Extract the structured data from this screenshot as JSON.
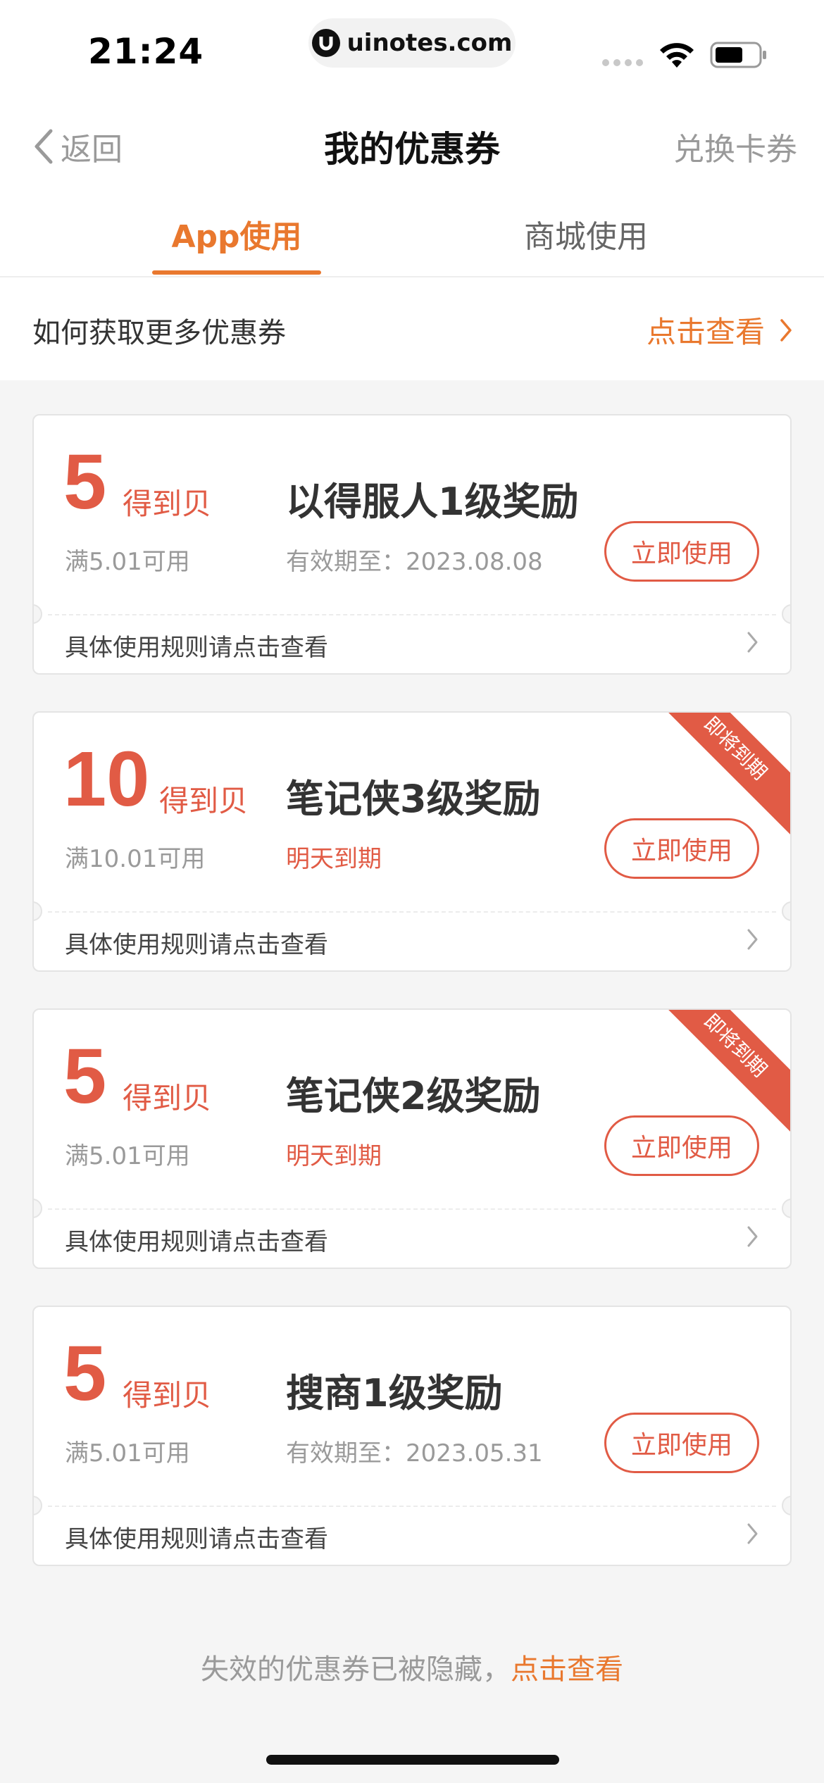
{
  "status_bar": {
    "time": "21:24",
    "url": "uinotes.com"
  },
  "nav": {
    "back_label": "返回",
    "title": "我的优惠券",
    "right_action": "兑换卡券"
  },
  "tabs": [
    {
      "label": "App使用",
      "active": true
    },
    {
      "label": "商城使用",
      "active": false
    }
  ],
  "info_row": {
    "label": "如何获取更多优惠券",
    "link": "点击查看"
  },
  "coupons": [
    {
      "amount": "5",
      "unit": "得到贝",
      "min_use": "满5.01可用",
      "title": "以得服人1级奖励",
      "expiry": "有效期至：2023.08.08",
      "expiry_urgent": false,
      "button": "立即使用",
      "rules": "具体使用规则请点击查看",
      "ribbon": ""
    },
    {
      "amount": "10",
      "unit": "得到贝",
      "min_use": "满10.01可用",
      "title": "笔记侠3级奖励",
      "expiry": "明天到期",
      "expiry_urgent": true,
      "button": "立即使用",
      "rules": "具体使用规则请点击查看",
      "ribbon": "即将到期"
    },
    {
      "amount": "5",
      "unit": "得到贝",
      "min_use": "满5.01可用",
      "title": "笔记侠2级奖励",
      "expiry": "明天到期",
      "expiry_urgent": true,
      "button": "立即使用",
      "rules": "具体使用规则请点击查看",
      "ribbon": "即将到期"
    },
    {
      "amount": "5",
      "unit": "得到贝",
      "min_use": "满5.01可用",
      "title": "搜商1级奖励",
      "expiry": "有效期至：2023.05.31",
      "expiry_urgent": false,
      "button": "立即使用",
      "rules": "具体使用规则请点击查看",
      "ribbon": ""
    }
  ],
  "footer": {
    "hidden_text": "失效的优惠券已被隐藏，",
    "hidden_link": "点击查看"
  },
  "colors": {
    "accent": "#e9782e",
    "coupon_red": "#e15b45"
  }
}
